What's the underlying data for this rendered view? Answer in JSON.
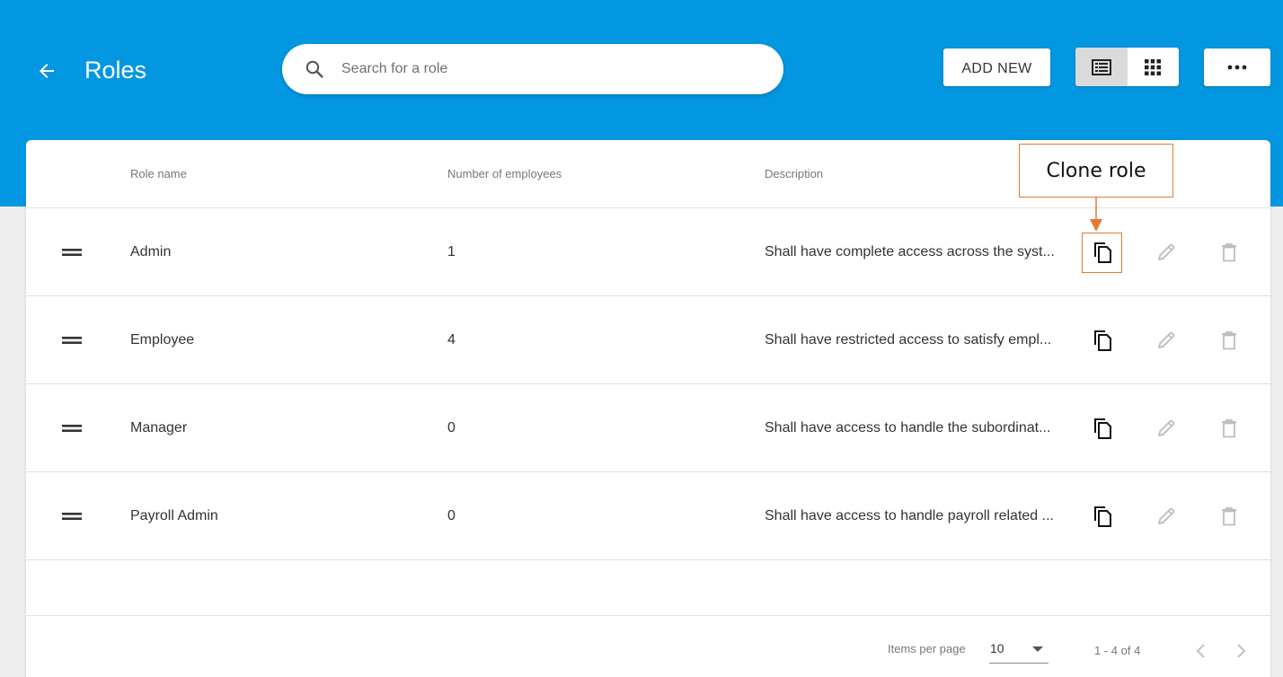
{
  "header": {
    "title": "Roles",
    "back_icon": "arrow-left-icon",
    "search": {
      "placeholder": "Search for a role",
      "value": ""
    },
    "add_new_label": "ADD NEW",
    "view_toggle": {
      "list_icon": "list-view-icon",
      "grid_icon": "grid-view-icon",
      "active": "list"
    },
    "more_icon": "more-horizontal-icon"
  },
  "colors": {
    "header_bg": "#0497e1",
    "callout": "#e07b33"
  },
  "table": {
    "columns": [
      "Role name",
      "Number of employees",
      "Description"
    ],
    "rows": [
      {
        "name": "Admin",
        "employees": "1",
        "description": "Shall have complete access across the syst..."
      },
      {
        "name": "Employee",
        "employees": "4",
        "description": "Shall have restricted access to satisfy empl..."
      },
      {
        "name": "Manager",
        "employees": "0",
        "description": "Shall have access to handle the subordinat..."
      },
      {
        "name": "Payroll Admin",
        "employees": "0",
        "description": "Shall have access to handle payroll related ..."
      }
    ],
    "row_icons": {
      "drag": "drag-handle-icon",
      "clone": "copy-icon",
      "edit": "pencil-icon",
      "delete": "trash-icon"
    }
  },
  "pagination": {
    "items_per_page_label": "Items per page",
    "items_per_page_value": "10",
    "range_label": "1 - 4 of 4"
  },
  "annotation": {
    "label": "Clone role"
  }
}
